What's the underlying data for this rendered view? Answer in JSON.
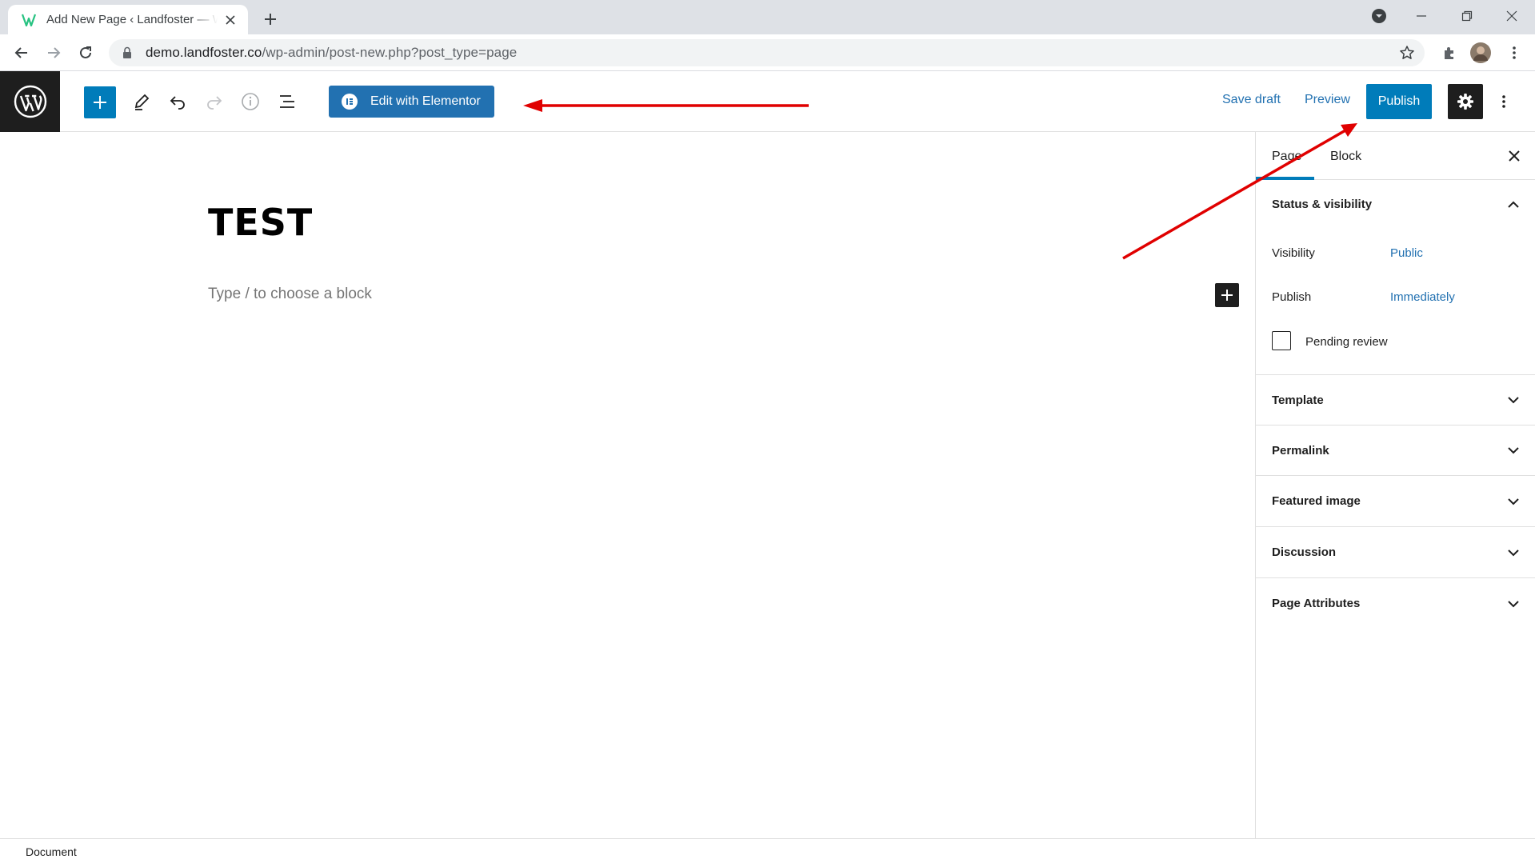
{
  "browser": {
    "tab_title": "Add New Page ‹ Landfoster — WordPress",
    "url_host": "demo.landfoster.co",
    "url_path": "/wp-admin/post-new.php?post_type=page",
    "icons": [
      "wordpress-favicon",
      "close-icon",
      "plus-icon",
      "profile-dropdown-icon",
      "minimize-icon",
      "restore-icon",
      "window-close-icon",
      "back-icon",
      "forward-icon",
      "reload-icon",
      "lock-icon",
      "star-icon",
      "extensions-icon",
      "avatar",
      "kebab-menu-icon"
    ]
  },
  "toolbar": {
    "inserter_icon": "plus-icon",
    "tools_icon": "pencil-icon",
    "undo_icon": "undo-icon",
    "redo_icon": "redo-icon",
    "info_icon": "info-icon",
    "outline_icon": "list-view-icon",
    "elementor_label": "Edit with Elementor",
    "save_draft_label": "Save draft",
    "preview_label": "Preview",
    "publish_label": "Publish",
    "settings_icon": "gear-icon",
    "more_icon": "kebab-menu-icon",
    "accent_color": "#007cba"
  },
  "editor": {
    "post_title": "TEST",
    "block_placeholder": "Type / to choose a block"
  },
  "sidebar": {
    "tabs": [
      {
        "label": "Page",
        "active": true
      },
      {
        "label": "Block",
        "active": false
      }
    ],
    "status_panel": {
      "title": "Status & visibility",
      "visibility_label": "Visibility",
      "visibility_value": "Public",
      "publish_label": "Publish",
      "publish_value": "Immediately",
      "pending_label": "Pending review",
      "pending_checked": false
    },
    "panels": [
      {
        "title": "Template"
      },
      {
        "title": "Permalink"
      },
      {
        "title": "Featured image"
      },
      {
        "title": "Discussion"
      },
      {
        "title": "Page Attributes"
      }
    ]
  },
  "footer": {
    "breadcrumb": "Document"
  },
  "annotations": {
    "arrow_color": "#e00000"
  }
}
